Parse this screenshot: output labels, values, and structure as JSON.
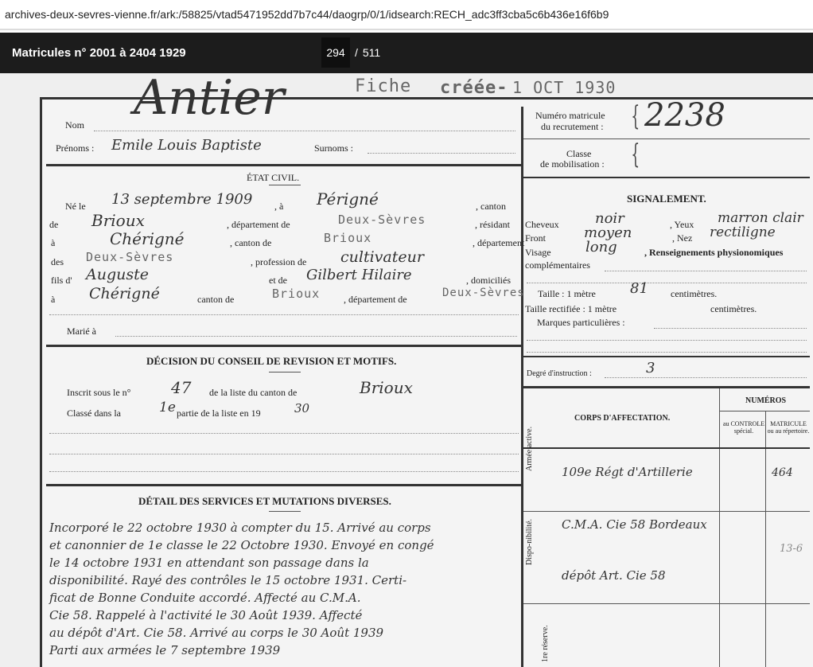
{
  "browser": {
    "url": "archives-deux-sevres-vienne.fr/ark:/58825/vtad5471952dd7b7c44/daogrp/0/1/idsearch:RECH_adc3ff3cba5c6b436e16f6b99"
  },
  "viewer": {
    "title": "Matricules n° 2001 à 2404 1929",
    "current_page": "294",
    "separator": "/",
    "total_pages": "511"
  },
  "document": {
    "stamp_fiche": "Fiche",
    "stamp_creee": "créée-",
    "stamp_date": "1 OCT 1930",
    "nom_label": "Nom",
    "nom_value": "Antier",
    "prenoms_label": "Prénoms :",
    "prenoms_value": "Emile Louis Baptiste",
    "surnoms_label": "Surnoms :",
    "numero_label_1": "Numéro matricule",
    "numero_label_2": "du recrutement :",
    "numero_value": "2238",
    "classe_label_1": "Classe",
    "classe_label_2": "de mobilisation :",
    "etat_civil": "ÉTAT CIVIL.",
    "ne_le": "Né le",
    "ne_date": "13 septembre 1909",
    "a_label": ", à",
    "ne_lieu": "Périgné",
    "canton_label": ", canton",
    "de_label": "de",
    "canton_value": "Brioux",
    "departement_label": ", département de",
    "departement_value": "Deux-Sèvres",
    "residant_label": ", résidant",
    "a2_label": "à",
    "residant_value": "Chérigné",
    "canton_de_label": ", canton de",
    "canton_de_value": "Brioux",
    "departement_label_2": ", département",
    "des_label": "des",
    "departement_value_2": "Deux-Sèvres",
    "profession_label": ", profession de",
    "profession_value": "cultivateur",
    "fils_label": "fils d'",
    "fils_value": "Auguste",
    "et_de_label": "et de",
    "mere_value": "Gilbert Hilaire",
    "domicilies_label": ", domiciliés",
    "a3_label": "à",
    "domicile_value": "Chérigné",
    "canton_de_label_2": "canton de",
    "domicile_canton": "Brioux",
    "departement_label_3": ", département de",
    "domicile_departement": "Deux-Sèvres",
    "marie_label": "Marié à",
    "signalement": "SIGNALEMENT.",
    "cheveux_label": "Cheveux",
    "cheveux_value": "noir",
    "yeux_label": ", Yeux",
    "yeux_value": "marron clair",
    "front_label": "Front",
    "front_value": "moyen",
    "nez_label": ", Nez",
    "nez_value": "rectiligne",
    "visage_label": "Visage",
    "visage_value": "long",
    "renseignements_label": ", Renseignements physionomiques",
    "complementaires_label": "complémentaires",
    "taille_label": "Taille : 1 mètre",
    "taille_value": "81",
    "centimetres_label": "centimètres.",
    "taille_rectifiee_label": "Taille rectifiée : 1 mètre",
    "centimetres_label_2": "centimètres.",
    "marques_label": "Marques particulières :",
    "decision": "DÉCISION DU CONSEIL DE REVISION ET MOTIFS.",
    "inscrit_label": "Inscrit sous le n°",
    "inscrit_value": "47",
    "liste_canton_label": "de la liste du canton de",
    "liste_canton_value": "Brioux",
    "classe_dans_label": "Classé dans la",
    "classe_dans_value": "1e",
    "partie_label": "partie de la liste en 19",
    "partie_value": "30",
    "degre_label": "Degré d'instruction :",
    "degre_value": "3",
    "numeros_label": "NUMÉROS",
    "corps_label": "CORPS D'AFFECTATION.",
    "au_controle": "au CONTROLE spécial.",
    "matricule_repertoire": "MATRICULE ou au répertoire.",
    "detail": "DÉTAIL DES SERVICES ET MUTATIONS DIVERSES.",
    "armee_active": "Armée active.",
    "disponibilite": "Dispo-nibilité.",
    "reserve": "1re réserve.",
    "corps_1": "109e Régt d'Artillerie",
    "matricule_1": "464",
    "corps_2": "C.M.A. Cie 58 Bordeaux",
    "corps_2_note": "13-6",
    "corps_3": "dépôt Art. Cie 58",
    "services_lines": [
      "Incorporé le 22 octobre 1930 à compter du 15. Arrivé au corps",
      "et canonnier de 1e classe le 22 Octobre 1930. Envoyé en congé",
      "le 14 octobre 1931 en attendant son passage dans la",
      "disponibilité. Rayé des contrôles le 15 octobre 1931. Certi-",
      "ficat de Bonne Conduite accordé. Affecté au C.M.A.",
      "Cie 58. Rappelé à l'activité le 30 Août 1939. Affecté",
      "au dépôt d'Art. Cie 58. Arrivé au corps le 30 Août 1939",
      "Parti aux armées le 7 septembre 1939"
    ]
  }
}
